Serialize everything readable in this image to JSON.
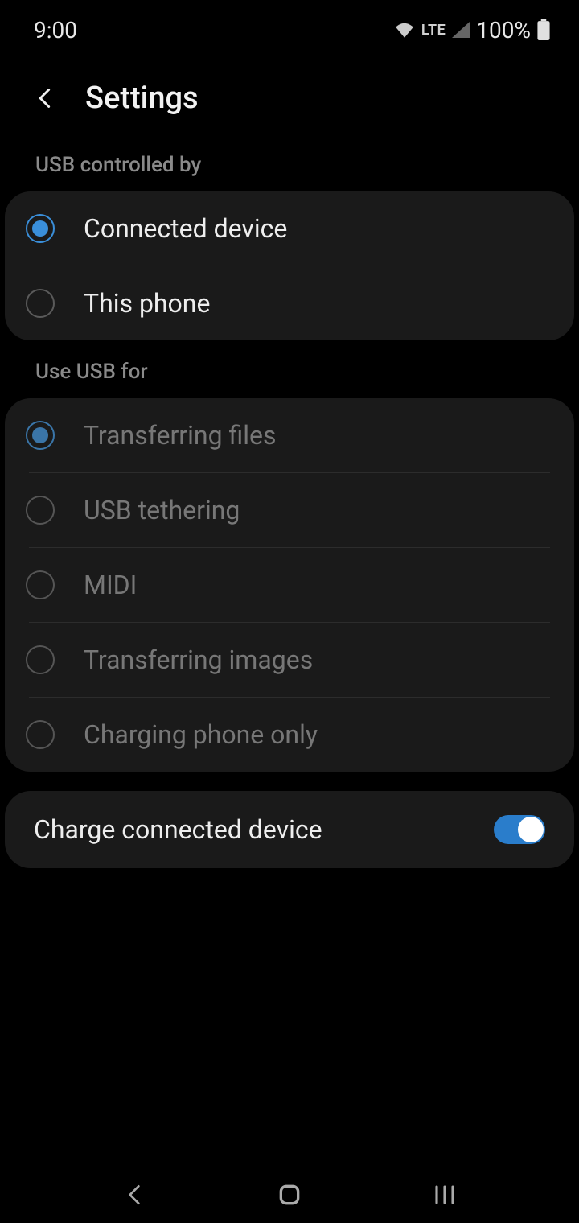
{
  "status_bar": {
    "time": "9:00",
    "network_type": "LTE",
    "battery_percent": "100%"
  },
  "header": {
    "title": "Settings"
  },
  "sections": {
    "usb_controlled_by": {
      "header": "USB controlled by",
      "options": [
        {
          "label": "Connected device",
          "selected": true
        },
        {
          "label": "This phone",
          "selected": false
        }
      ]
    },
    "use_usb_for": {
      "header": "Use USB for",
      "options": [
        {
          "label": "Transferring files",
          "selected": true
        },
        {
          "label": "USB tethering",
          "selected": false
        },
        {
          "label": "MIDI",
          "selected": false
        },
        {
          "label": "Transferring images",
          "selected": false
        },
        {
          "label": "Charging phone only",
          "selected": false
        }
      ]
    },
    "charge_connected": {
      "label": "Charge connected device",
      "enabled": true
    }
  }
}
